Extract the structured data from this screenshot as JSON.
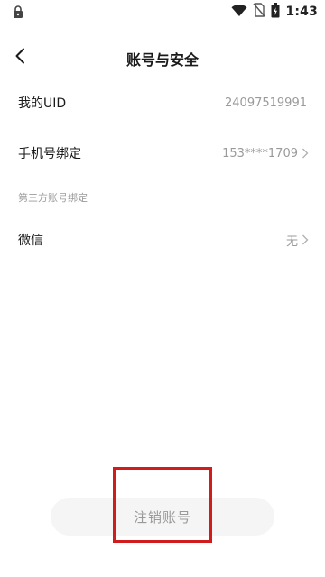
{
  "status_bar": {
    "time": "1:43",
    "icons": [
      "lock-icon",
      "wifi-icon",
      "no-sim-icon",
      "battery-icon"
    ]
  },
  "header": {
    "back_icon": "chevron-left-icon",
    "title": "账号与安全"
  },
  "rows": {
    "uid": {
      "label": "我的UID",
      "value": "24097519991"
    },
    "phone": {
      "label": "手机号绑定",
      "value": "153****1709"
    },
    "third_party_section": "第三方账号绑定",
    "wechat": {
      "label": "微信",
      "value": "无"
    }
  },
  "footer": {
    "cancel_account_label": "注销账号"
  },
  "colors": {
    "highlight": "#d01c1c",
    "muted_text": "#9a9a9a",
    "button_bg": "#f5f5f5"
  }
}
